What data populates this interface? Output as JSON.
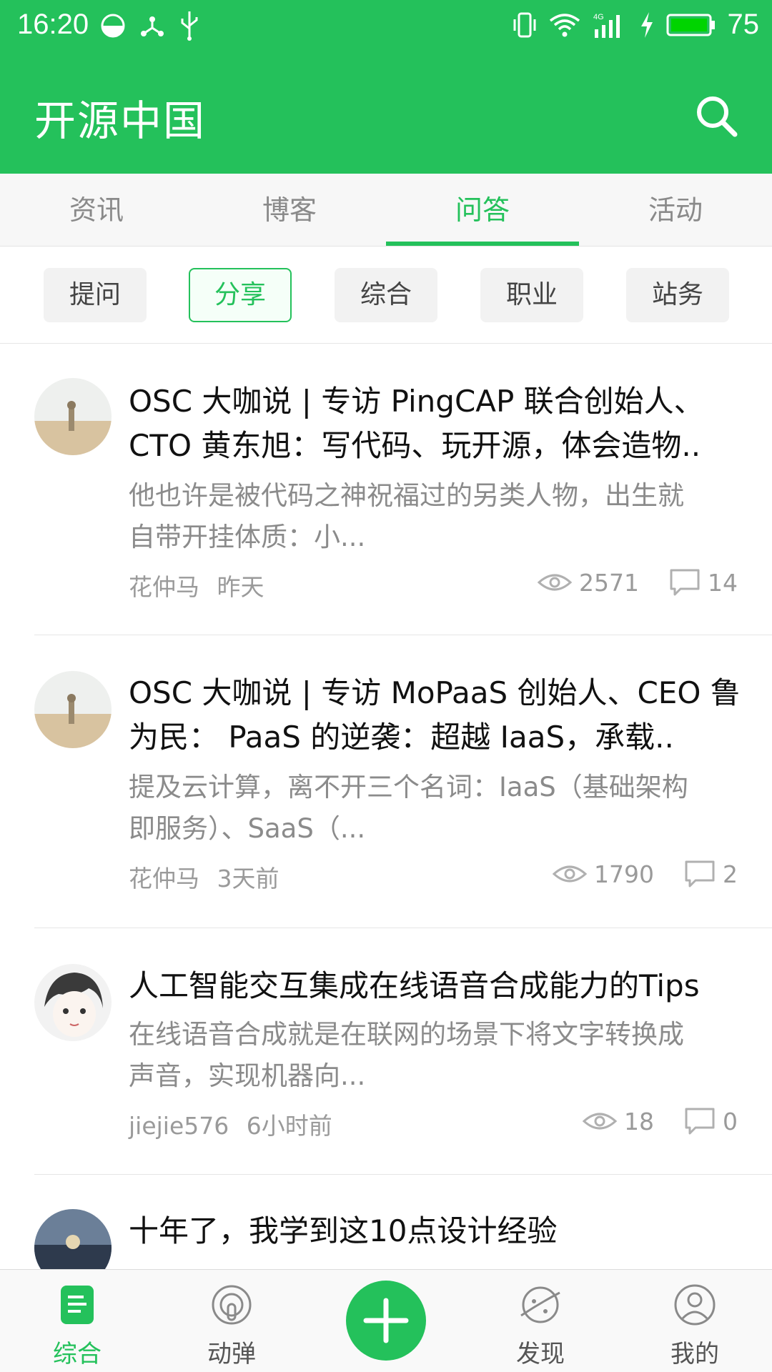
{
  "status_bar": {
    "time": "16:20",
    "battery_percent": "75"
  },
  "app_bar": {
    "title": "开源中国"
  },
  "tabs": [
    {
      "label": "资讯",
      "active": false
    },
    {
      "label": "博客",
      "active": false
    },
    {
      "label": "问答",
      "active": true
    },
    {
      "label": "活动",
      "active": false
    }
  ],
  "filters": [
    {
      "label": "提问",
      "selected": false
    },
    {
      "label": "分享",
      "selected": true
    },
    {
      "label": "综合",
      "selected": false
    },
    {
      "label": "职业",
      "selected": false
    },
    {
      "label": "站务",
      "selected": false
    }
  ],
  "feed": [
    {
      "title_line1": "OSC 大咖说 | 专访 PingCAP 联合创始人、",
      "title_line2": "CTO 黄东旭：写代码、玩开源，体会造物..",
      "summary_line1": "他也许是被代码之神祝福过的另类人物，出生就",
      "summary_line2": "自带开挂体质：小...",
      "author": "花仲马",
      "time": "昨天",
      "views": "2571",
      "comments": "14"
    },
    {
      "title_line1": "OSC 大咖说 | 专访 MoPaaS 创始人、CEO 鲁",
      "title_line2": "为民： PaaS 的逆袭：超越 IaaS，承载..",
      "summary_line1": "提及云计算，离不开三个名词：IaaS（基础架构",
      "summary_line2": "即服务）、SaaS（...",
      "author": "花仲马",
      "time": "3天前",
      "views": "1790",
      "comments": "2"
    },
    {
      "title_line1": "人工智能交互集成在线语音合成能力的Tips",
      "summary_line1": "在线语音合成就是在联网的场景下将文字转换成",
      "summary_line2": "声音，实现机器向...",
      "author": "jiejie576",
      "time": "6小时前",
      "views": "18",
      "comments": "0"
    },
    {
      "title_line1": "十年了，我学到这10点设计经验"
    }
  ],
  "bottom_nav": [
    {
      "label": "综合",
      "icon": "news-icon",
      "active": true
    },
    {
      "label": "动弹",
      "icon": "podcast-icon",
      "active": false
    },
    {
      "label": "发现",
      "icon": "planet-icon",
      "active": false
    },
    {
      "label": "我的",
      "icon": "user-icon",
      "active": false
    }
  ],
  "fab": {
    "icon": "plus-icon"
  },
  "colors": {
    "brand_green": "#24c15b",
    "muted_text": "#8b8b8b",
    "title_text": "#111111"
  }
}
